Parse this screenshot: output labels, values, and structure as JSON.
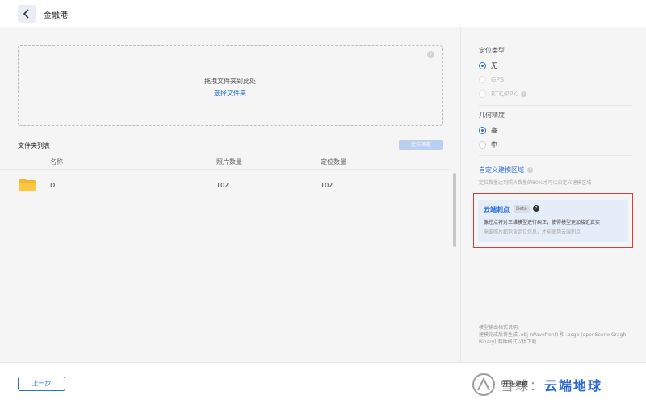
{
  "header": {
    "title": "金融港",
    "back_icon": "chevron-left-icon"
  },
  "upload": {
    "drop_text": "拖拽文件夹到此处",
    "select_link": "选择文件夹",
    "help_icon_text": "?"
  },
  "folder_list": {
    "title": "文件夹列表",
    "preview_button": "定位预览",
    "columns": [
      "名称",
      "照片数量",
      "定位数量"
    ],
    "rows": [
      {
        "name": "D",
        "photo_count": "102",
        "position_count": "102",
        "icon": "folder-icon"
      }
    ]
  },
  "settings": {
    "positioning_type": {
      "label": "定位类型",
      "options": [
        {
          "label": "无",
          "checked": true,
          "disabled": false
        },
        {
          "label": "GPS",
          "checked": false,
          "disabled": true
        },
        {
          "label": "RTK/PPK",
          "checked": false,
          "disabled": true
        }
      ],
      "info_text": "i"
    },
    "geometric_precision": {
      "label": "几何精度",
      "options": [
        {
          "label": "高",
          "checked": true
        },
        {
          "label": "中",
          "checked": false
        }
      ]
    },
    "custom_region": {
      "link": "自定义建模区域",
      "info_text": "i",
      "description": "定位数量达到照片数量的80%才可以自定义建模区域"
    },
    "cloud_stab": {
      "title": "云端刺点",
      "badge": "Beta",
      "info_text": "?",
      "line1": "像控点将对三维模型进行纠正，使得模型更加接近真实",
      "line2": "需要照片都包含定位信息，才能使用云端刺点"
    },
    "format_note": "模型输出格式说明:\n建模完成后将生成 .obj (Wavefront) 和 .osgb (openScene Gragh Binary) 两种格式以供下载"
  },
  "footer": {
    "prev_button": "上一步",
    "start_text": "开始建模",
    "watermark_text": "雪球：",
    "watermark_brand": "云端地球"
  },
  "colors": {
    "accent": "#2b6fd6",
    "highlight": "#e23a3a"
  }
}
